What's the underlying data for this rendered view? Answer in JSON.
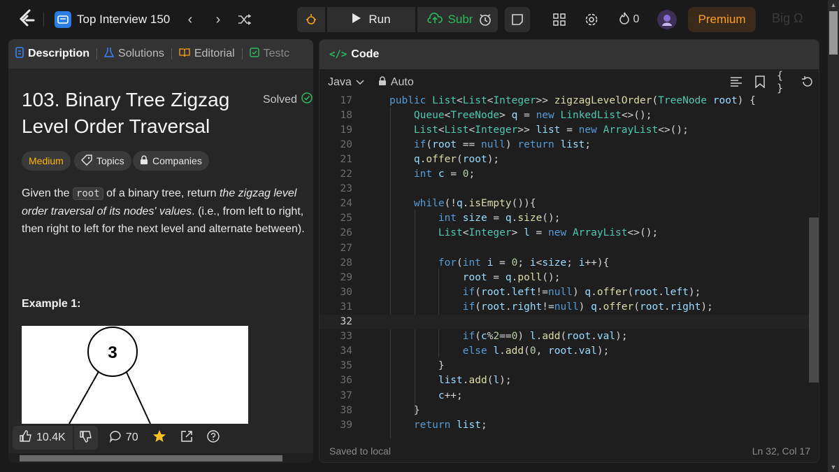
{
  "topbar": {
    "logo_icon": "leetcode-logo-icon",
    "list_title": "Top Interview 150",
    "run_label": "Run",
    "submit_label": "Submit",
    "streak_count": "0",
    "premium_label": "Premium",
    "bigo_label": "Big Ω"
  },
  "left": {
    "tabs": [
      {
        "label": "Description",
        "icon": "description-icon"
      },
      {
        "label": "Solutions",
        "icon": "flask-icon"
      },
      {
        "label": "Editorial",
        "icon": "book-icon"
      },
      {
        "label": "Testc",
        "icon": "checkbox-icon"
      }
    ],
    "problem_title": "103. Binary Tree Zigzag Level Order Traversal",
    "solved_label": "Solved",
    "chips": {
      "difficulty": "Medium",
      "topics": "Topics",
      "companies": "Companies"
    },
    "desc": {
      "p1": "Given the",
      "code": "root",
      "p2": "of a binary tree, return",
      "em": "the zigzag level order traversal of its nodes' values",
      "p3": ". (i.e., from left to right, then right to left for the next level and alternate between)."
    },
    "example_title": "Example 1:",
    "example_node": "3",
    "footer": {
      "likes": "10.4K",
      "comments": "70"
    }
  },
  "right": {
    "header_title": "Code",
    "language": "Java",
    "mode": "Auto",
    "status_left": "Saved to local",
    "status_right": "Ln 32, Col 17",
    "lines": [
      {
        "n": "17"
      },
      {
        "n": "18"
      },
      {
        "n": "19"
      },
      {
        "n": "20"
      },
      {
        "n": "21"
      },
      {
        "n": "22"
      },
      {
        "n": "23"
      },
      {
        "n": "24"
      },
      {
        "n": "25"
      },
      {
        "n": "26"
      },
      {
        "n": "27"
      },
      {
        "n": "28"
      },
      {
        "n": "29"
      },
      {
        "n": "30"
      },
      {
        "n": "31"
      },
      {
        "n": "32"
      },
      {
        "n": "33"
      },
      {
        "n": "34"
      },
      {
        "n": "35"
      },
      {
        "n": "36"
      },
      {
        "n": "37"
      },
      {
        "n": "38"
      },
      {
        "n": "39"
      }
    ],
    "code": [
      "public List<List<Integer>> zigzagLevelOrder(TreeNode root) {",
      "    Queue<TreeNode> q = new LinkedList<>();",
      "    List<List<Integer>> list = new ArrayList<>();",
      "    if(root == null) return list;",
      "    q.offer(root);",
      "    int c = 0;",
      "",
      "    while(!q.isEmpty()){",
      "        int size = q.size();",
      "        List<Integer> l = new ArrayList<>();",
      "",
      "        for(int i = 0; i<size; i++){",
      "            root = q.poll();",
      "            if(root.left!=null) q.offer(root.left);",
      "            if(root.right!=null) q.offer(root.right);",
      "",
      "            if(c%2==0) l.add(root.val);",
      "            else l.add(0, root.val);",
      "        }",
      "        list.add(l);",
      "        c++;",
      "    }",
      "    return list;"
    ]
  }
}
